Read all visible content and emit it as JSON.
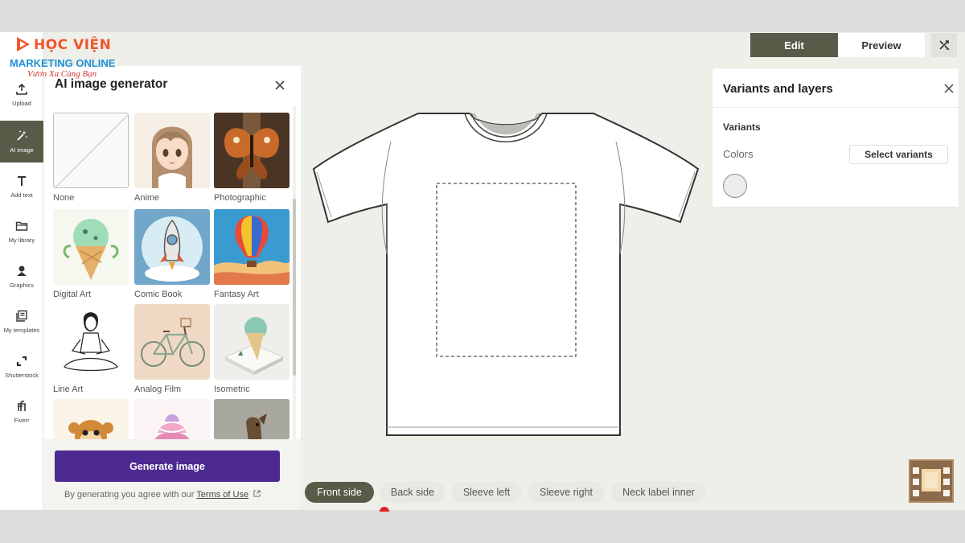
{
  "logo": {
    "line1": "HỌC VIỆN",
    "line2": "MARKETING ONLINE",
    "line3": "Vươn Xa Cùng Bạn"
  },
  "rail": {
    "items": [
      {
        "label": "Upload",
        "icon": "upload-icon"
      },
      {
        "label": "AI image",
        "icon": "magic-wand-icon",
        "active": true
      },
      {
        "label": "Add text",
        "icon": "text-icon"
      },
      {
        "label": "My library",
        "icon": "folder-icon"
      },
      {
        "label": "Graphics",
        "icon": "shapes-icon"
      },
      {
        "label": "My templates",
        "icon": "templates-icon"
      },
      {
        "label": "Shutterstock",
        "icon": "shutterstock-icon"
      },
      {
        "label": "Fiverr",
        "icon": "fiverr-icon"
      }
    ]
  },
  "panel": {
    "title": "AI image generator",
    "styles": [
      {
        "label": "None"
      },
      {
        "label": "Anime"
      },
      {
        "label": "Photographic"
      },
      {
        "label": "Digital Art"
      },
      {
        "label": "Comic Book"
      },
      {
        "label": "Fantasy Art"
      },
      {
        "label": "Line Art"
      },
      {
        "label": "Analog Film"
      },
      {
        "label": "Isometric"
      },
      {
        "label": ""
      },
      {
        "label": ""
      },
      {
        "label": ""
      }
    ],
    "generate_label": "Generate image",
    "terms_prefix": "By generating you agree with our ",
    "terms_link": "Terms of Use"
  },
  "header": {
    "edit": "Edit",
    "preview": "Preview"
  },
  "variants": {
    "title": "Variants and layers",
    "section": "Variants",
    "colors_label": "Colors",
    "select_label": "Select variants",
    "swatch_color": "#ececea"
  },
  "sides": [
    {
      "label": "Front side",
      "active": true
    },
    {
      "label": "Back side"
    },
    {
      "label": "Sleeve left"
    },
    {
      "label": "Sleeve right"
    },
    {
      "label": "Neck label inner"
    }
  ],
  "colors": {
    "accent": "#5a5a48",
    "generate": "#4d2a91",
    "canvas": "#efefea"
  }
}
